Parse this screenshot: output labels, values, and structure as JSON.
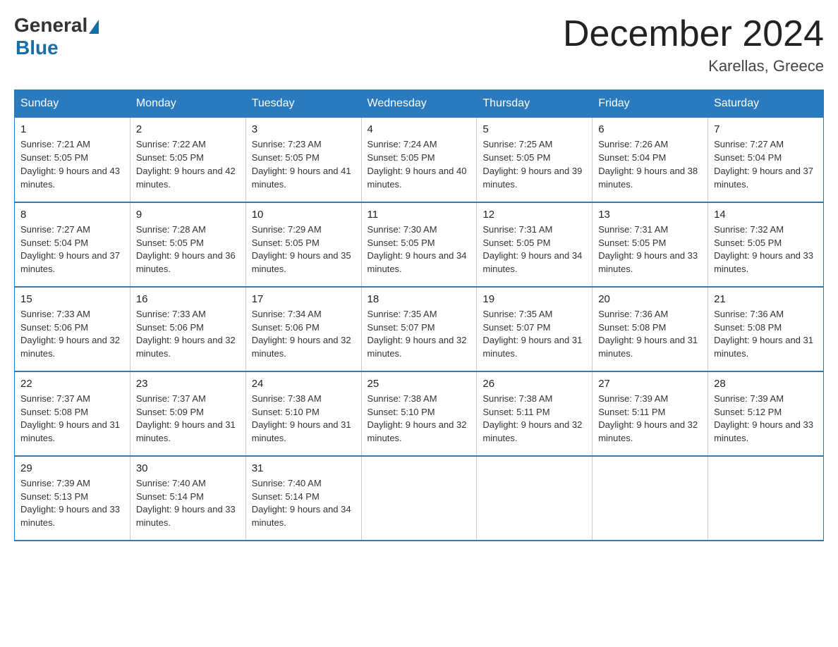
{
  "logo": {
    "general": "General",
    "blue": "Blue"
  },
  "title": "December 2024",
  "location": "Karellas, Greece",
  "days_of_week": [
    "Sunday",
    "Monday",
    "Tuesday",
    "Wednesday",
    "Thursday",
    "Friday",
    "Saturday"
  ],
  "weeks": [
    [
      {
        "day": "1",
        "sunrise": "7:21 AM",
        "sunset": "5:05 PM",
        "daylight": "9 hours and 43 minutes."
      },
      {
        "day": "2",
        "sunrise": "7:22 AM",
        "sunset": "5:05 PM",
        "daylight": "9 hours and 42 minutes."
      },
      {
        "day": "3",
        "sunrise": "7:23 AM",
        "sunset": "5:05 PM",
        "daylight": "9 hours and 41 minutes."
      },
      {
        "day": "4",
        "sunrise": "7:24 AM",
        "sunset": "5:05 PM",
        "daylight": "9 hours and 40 minutes."
      },
      {
        "day": "5",
        "sunrise": "7:25 AM",
        "sunset": "5:05 PM",
        "daylight": "9 hours and 39 minutes."
      },
      {
        "day": "6",
        "sunrise": "7:26 AM",
        "sunset": "5:04 PM",
        "daylight": "9 hours and 38 minutes."
      },
      {
        "day": "7",
        "sunrise": "7:27 AM",
        "sunset": "5:04 PM",
        "daylight": "9 hours and 37 minutes."
      }
    ],
    [
      {
        "day": "8",
        "sunrise": "7:27 AM",
        "sunset": "5:04 PM",
        "daylight": "9 hours and 37 minutes."
      },
      {
        "day": "9",
        "sunrise": "7:28 AM",
        "sunset": "5:05 PM",
        "daylight": "9 hours and 36 minutes."
      },
      {
        "day": "10",
        "sunrise": "7:29 AM",
        "sunset": "5:05 PM",
        "daylight": "9 hours and 35 minutes."
      },
      {
        "day": "11",
        "sunrise": "7:30 AM",
        "sunset": "5:05 PM",
        "daylight": "9 hours and 34 minutes."
      },
      {
        "day": "12",
        "sunrise": "7:31 AM",
        "sunset": "5:05 PM",
        "daylight": "9 hours and 34 minutes."
      },
      {
        "day": "13",
        "sunrise": "7:31 AM",
        "sunset": "5:05 PM",
        "daylight": "9 hours and 33 minutes."
      },
      {
        "day": "14",
        "sunrise": "7:32 AM",
        "sunset": "5:05 PM",
        "daylight": "9 hours and 33 minutes."
      }
    ],
    [
      {
        "day": "15",
        "sunrise": "7:33 AM",
        "sunset": "5:06 PM",
        "daylight": "9 hours and 32 minutes."
      },
      {
        "day": "16",
        "sunrise": "7:33 AM",
        "sunset": "5:06 PM",
        "daylight": "9 hours and 32 minutes."
      },
      {
        "day": "17",
        "sunrise": "7:34 AM",
        "sunset": "5:06 PM",
        "daylight": "9 hours and 32 minutes."
      },
      {
        "day": "18",
        "sunrise": "7:35 AM",
        "sunset": "5:07 PM",
        "daylight": "9 hours and 32 minutes."
      },
      {
        "day": "19",
        "sunrise": "7:35 AM",
        "sunset": "5:07 PM",
        "daylight": "9 hours and 31 minutes."
      },
      {
        "day": "20",
        "sunrise": "7:36 AM",
        "sunset": "5:08 PM",
        "daylight": "9 hours and 31 minutes."
      },
      {
        "day": "21",
        "sunrise": "7:36 AM",
        "sunset": "5:08 PM",
        "daylight": "9 hours and 31 minutes."
      }
    ],
    [
      {
        "day": "22",
        "sunrise": "7:37 AM",
        "sunset": "5:08 PM",
        "daylight": "9 hours and 31 minutes."
      },
      {
        "day": "23",
        "sunrise": "7:37 AM",
        "sunset": "5:09 PM",
        "daylight": "9 hours and 31 minutes."
      },
      {
        "day": "24",
        "sunrise": "7:38 AM",
        "sunset": "5:10 PM",
        "daylight": "9 hours and 31 minutes."
      },
      {
        "day": "25",
        "sunrise": "7:38 AM",
        "sunset": "5:10 PM",
        "daylight": "9 hours and 32 minutes."
      },
      {
        "day": "26",
        "sunrise": "7:38 AM",
        "sunset": "5:11 PM",
        "daylight": "9 hours and 32 minutes."
      },
      {
        "day": "27",
        "sunrise": "7:39 AM",
        "sunset": "5:11 PM",
        "daylight": "9 hours and 32 minutes."
      },
      {
        "day": "28",
        "sunrise": "7:39 AM",
        "sunset": "5:12 PM",
        "daylight": "9 hours and 33 minutes."
      }
    ],
    [
      {
        "day": "29",
        "sunrise": "7:39 AM",
        "sunset": "5:13 PM",
        "daylight": "9 hours and 33 minutes."
      },
      {
        "day": "30",
        "sunrise": "7:40 AM",
        "sunset": "5:14 PM",
        "daylight": "9 hours and 33 minutes."
      },
      {
        "day": "31",
        "sunrise": "7:40 AM",
        "sunset": "5:14 PM",
        "daylight": "9 hours and 34 minutes."
      },
      null,
      null,
      null,
      null
    ]
  ],
  "labels": {
    "sunrise": "Sunrise:",
    "sunset": "Sunset:",
    "daylight": "Daylight:"
  }
}
